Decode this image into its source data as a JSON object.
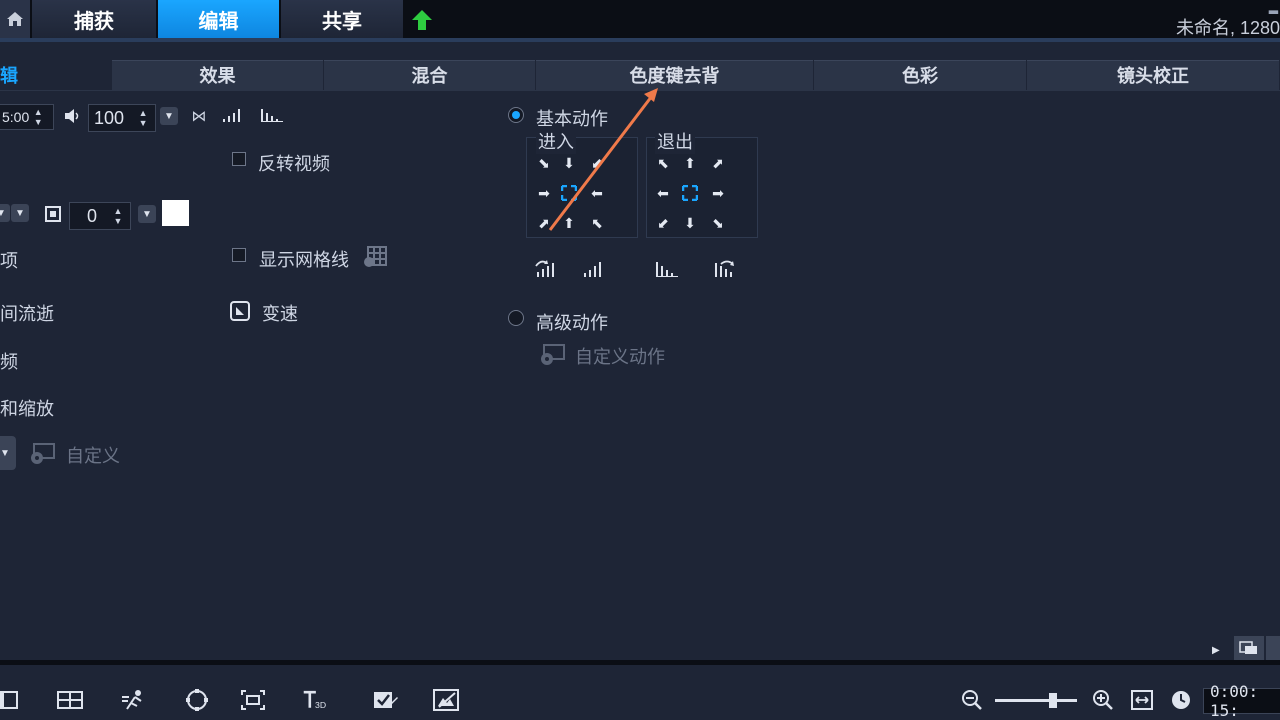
{
  "top_tabs": [
    {
      "label": "捕获",
      "active": false
    },
    {
      "label": "编辑",
      "active": true
    },
    {
      "label": "共享",
      "active": false
    }
  ],
  "file_title": "未命名, 1280",
  "sub_tabs": [
    {
      "label": "编辑",
      "partial": "编辑"
    },
    {
      "label": "效果"
    },
    {
      "label": "混合"
    },
    {
      "label": "色度键去背"
    },
    {
      "label": "色彩"
    },
    {
      "label": "镜头校正"
    }
  ],
  "left_panel": {
    "duration_value": "5:00",
    "volume_value": "100",
    "border_value": "0",
    "border_color": "#ffffff",
    "options_label_partial": "选项",
    "time_lapse_partial": "时间流逝",
    "video_partial": "视频",
    "pan_zoom_partial": "移动和缩放",
    "custom_label": "自定义"
  },
  "middle_panel": {
    "reverse_video": "反转视频",
    "show_grid": "显示网格线",
    "speed_change": "变速"
  },
  "motion": {
    "basic_label": "基本动作",
    "enter_label": "进入",
    "exit_label": "退出",
    "advanced_label": "高级动作",
    "custom_motion": "自定义动作",
    "basic_selected": true
  },
  "timeline": {
    "timecode": "0:00: 15:"
  },
  "colors": {
    "accent": "#1aa6ff",
    "background": "#1e2536",
    "annotation_arrow": "#f07a4a",
    "upload_green": "#2ecc40"
  }
}
